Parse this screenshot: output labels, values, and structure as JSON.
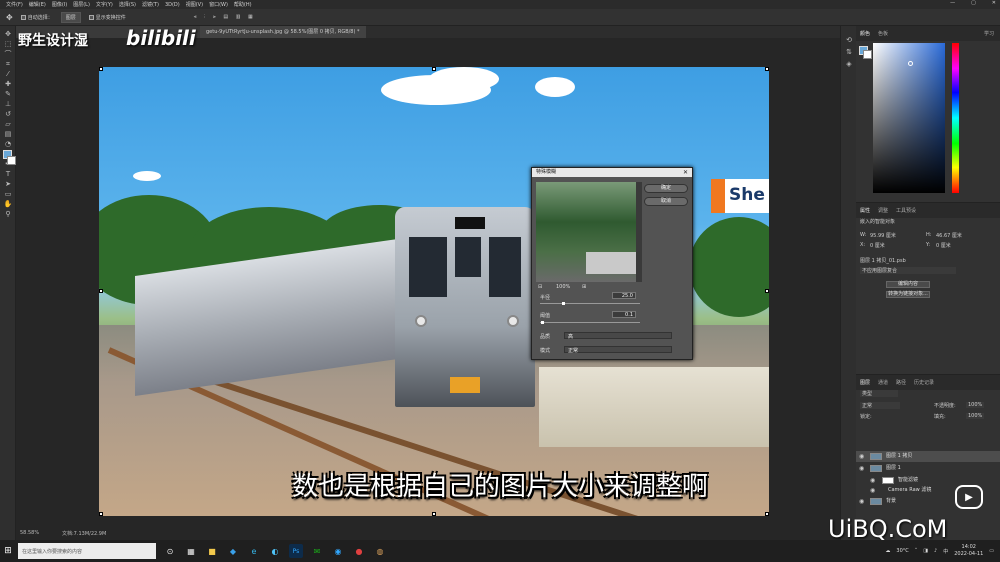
{
  "menubar": {
    "items": [
      "文件(F)",
      "编辑(E)",
      "图像(I)",
      "图层(L)",
      "文字(Y)",
      "选择(S)",
      "滤镜(T)",
      "3D(D)",
      "视图(V)",
      "窗口(W)",
      "帮助(H)"
    ],
    "window_controls": [
      "—",
      "▢",
      "✕"
    ]
  },
  "options_bar": {
    "auto_select_label": "自动选择：",
    "auto_select_value": "图层",
    "show_transform_label": "显示变换控件"
  },
  "overlay": {
    "channel_name": "野生设计湿",
    "bilibili": "bilibili",
    "caption": "数也是根据自己的图片大小来调整啊",
    "watermark": "UiBQ.CoM",
    "play_icon": "▶"
  },
  "document": {
    "tab_title": "getu-9yUTtRyrtJu-unsplash.jpg @ 58.5%(图层 0 拷贝, RGB/8) *",
    "zoom": "58.58%",
    "doc_info": "文档:7.13M/22.9M",
    "sign_text": "She"
  },
  "dialog": {
    "title": "特殊模糊",
    "close": "✕",
    "ok": "确定",
    "cancel": "取消",
    "zoom": "100%",
    "radius_label": "半径",
    "radius_value": "25.0",
    "threshold_label": "阈值",
    "threshold_value": "0.1",
    "quality_label": "品质",
    "quality_value": "高",
    "mode_label": "模式",
    "mode_value": "正常"
  },
  "right_panel": {
    "color_tabs": [
      "颜色",
      "色板"
    ],
    "learn_label": "学习",
    "properties_tabs": [
      "属性",
      "调整",
      "工具预设"
    ],
    "smart_object_label": "嵌入的智能对象",
    "w_label": "W:",
    "w_value": "95.99 厘米",
    "h_label": "H:",
    "h_value": "46.67 厘米",
    "x_label": "X:",
    "x_value": "0 厘米",
    "y_label": "Y:",
    "y_value": "0 厘米",
    "file_label": "图层 1 拷贝_01.psb",
    "no_comp": "不应用图层复合",
    "edit_content": "编辑内容",
    "convert_linked": "转换为链接对象...",
    "layers_tabs": [
      "图层",
      "通道",
      "路径",
      "历史记录"
    ],
    "kind_label": "类型",
    "blend_mode": "正常",
    "opacity_label": "不透明度:",
    "opacity_value": "100%",
    "fill_label": "填充:",
    "fill_value": "100%",
    "lock_label": "锁定:",
    "layers": [
      {
        "name": "图层 1 拷贝",
        "selected": true
      },
      {
        "name": "图层 1",
        "selected": false
      },
      {
        "name": "智能滤镜",
        "selected": false
      },
      {
        "name": "Camera Raw 滤镜",
        "selected": false
      },
      {
        "name": "背景",
        "selected": false
      }
    ]
  },
  "taskbar": {
    "search_placeholder": "在这里输入你要搜索的内容",
    "weather": "30°C",
    "time": "14:02",
    "date": "2022-04-11",
    "lang": "中",
    "apps": [
      "⊙",
      "▦",
      "■",
      "◆",
      "e",
      "◐",
      "Ps",
      "✉",
      "◉",
      "●",
      "◍"
    ]
  },
  "colors": {
    "accent": "#2d8ed8",
    "fg_swatch": "#6aa8d8",
    "bg_swatch": "#ffffff"
  }
}
